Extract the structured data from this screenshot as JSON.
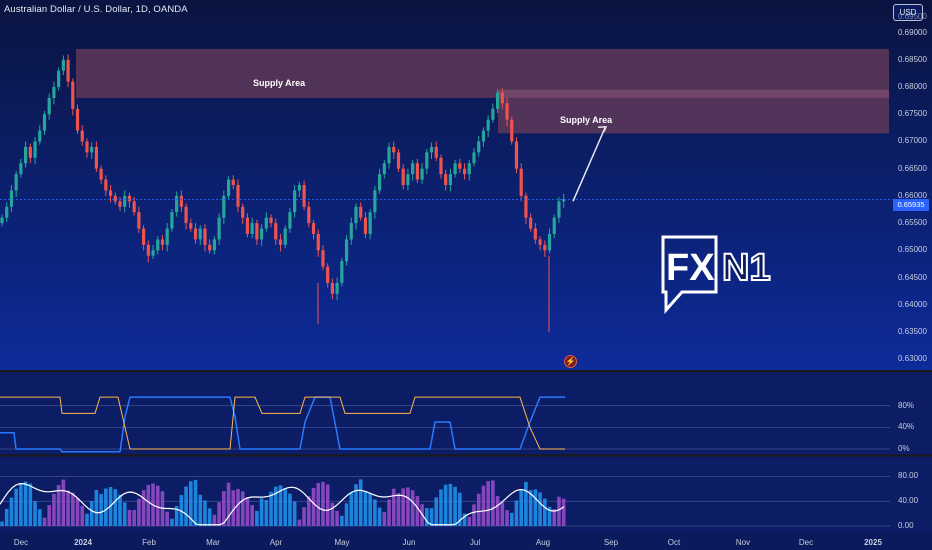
{
  "header": {
    "title": "Australian Dollar / U.S. Dollar, 1D, OANDA",
    "currency_button": "USD"
  },
  "price_axis": {
    "labels": [
      "0.69000",
      "0.68500",
      "0.68000",
      "0.67500",
      "0.67000",
      "0.66500",
      "0.66000",
      "0.65500",
      "0.65000",
      "0.64500",
      "0.64000",
      "0.63500",
      "0.63000"
    ],
    "top_cut_label": "0.69500",
    "current_price": "0.65935"
  },
  "time_axis": {
    "labels": [
      "Dec",
      "2024",
      "Feb",
      "Mar",
      "Apr",
      "May",
      "Jun",
      "Jul",
      "Aug",
      "Sep",
      "Oct",
      "Nov",
      "Dec",
      "2025"
    ]
  },
  "annotations": {
    "zone1_label": "Supply Area",
    "zone2_label": "Supply Area"
  },
  "logo": {
    "text_a": "FX",
    "text_b": "N1"
  },
  "indicator1": {
    "labels": [
      "80%",
      "40%",
      "0%"
    ]
  },
  "indicator2": {
    "labels": [
      "80.00",
      "40.00",
      "0.00"
    ]
  },
  "colors": {
    "background": "#0a1a5c",
    "up": "#26a69a",
    "down": "#ef5350",
    "zone": "#6b3c5a",
    "indicator_blue": "#2979ff",
    "indicator_orange": "#ffb74d",
    "hist_purple": "#9c4dcc",
    "hist_blue": "#2196f3"
  },
  "chart_data": {
    "type": "candlestick",
    "title": "Australian Dollar / U.S. Dollar, 1D, OANDA",
    "y_range": [
      0.628,
      0.696
    ],
    "supply_zones": [
      {
        "label": "Supply Area",
        "low": 0.678,
        "high": 0.687
      },
      {
        "label": "Supply Area",
        "low": 0.6715,
        "high": 0.6795
      }
    ],
    "closes": [
      0.656,
      0.658,
      0.661,
      0.664,
      0.666,
      0.669,
      0.667,
      0.67,
      0.672,
      0.675,
      0.678,
      0.68,
      0.683,
      0.685,
      0.681,
      0.676,
      0.672,
      0.67,
      0.668,
      0.669,
      0.665,
      0.663,
      0.661,
      0.66,
      0.659,
      0.658,
      0.66,
      0.659,
      0.657,
      0.654,
      0.651,
      0.649,
      0.65,
      0.652,
      0.651,
      0.654,
      0.657,
      0.66,
      0.658,
      0.655,
      0.654,
      0.652,
      0.654,
      0.651,
      0.65,
      0.652,
      0.656,
      0.66,
      0.663,
      0.662,
      0.658,
      0.656,
      0.653,
      0.655,
      0.652,
      0.654,
      0.656,
      0.655,
      0.652,
      0.651,
      0.654,
      0.657,
      0.661,
      0.662,
      0.658,
      0.655,
      0.653,
      0.65,
      0.647,
      0.644,
      0.642,
      0.644,
      0.648,
      0.652,
      0.655,
      0.658,
      0.656,
      0.653,
      0.657,
      0.661,
      0.664,
      0.666,
      0.669,
      0.668,
      0.665,
      0.662,
      0.664,
      0.666,
      0.663,
      0.665,
      0.668,
      0.669,
      0.667,
      0.664,
      0.662,
      0.664,
      0.666,
      0.665,
      0.664,
      0.666,
      0.668,
      0.67,
      0.672,
      0.674,
      0.676,
      0.679,
      0.677,
      0.674,
      0.67,
      0.665,
      0.66,
      0.656,
      0.654,
      0.652,
      0.651,
      0.65,
      0.653,
      0.656,
      0.659,
      0.6594
    ],
    "indicator1_series": [
      {
        "name": "",
        "color": "blue",
        "range_pct": [
          0,
          100
        ]
      },
      {
        "name": "",
        "color": "orange",
        "range_pct": [
          0,
          100
        ]
      }
    ],
    "indicator2_levels": [
      80,
      40,
      0
    ]
  }
}
